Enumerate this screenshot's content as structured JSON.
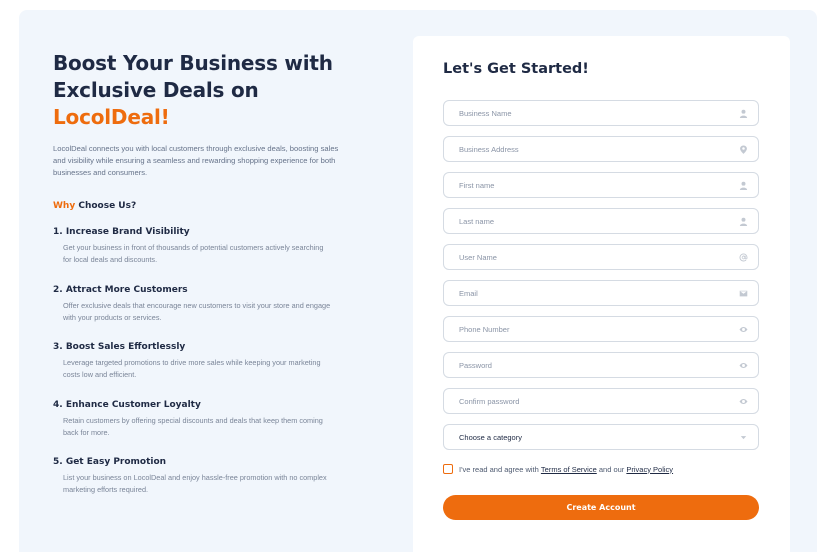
{
  "hero": {
    "title_line1": "Boost Your Business with",
    "title_line2": "Exclusive Deals on",
    "brand": "LocolDeal!",
    "intro": "LocolDeal connects you with local customers through exclusive deals, boosting sales and visibility while ensuring a seamless and rewarding shopping experience for both businesses and consumers."
  },
  "why": {
    "accent": "Why",
    "rest": " Choose Us?"
  },
  "features": [
    {
      "title": "1. Increase Brand Visibility",
      "desc": "Get your business in front of thousands of potential customers actively searching for local deals and discounts."
    },
    {
      "title": "2. Attract More Customers",
      "desc": "Offer exclusive deals that encourage new customers to visit your store and engage with your products or services."
    },
    {
      "title": "3. Boost Sales Effortlessly",
      "desc": "Leverage targeted promotions to drive more sales while keeping your marketing costs low and efficient."
    },
    {
      "title": "4. Enhance Customer Loyalty",
      "desc": "Retain customers by offering special discounts and deals that keep them coming back for more."
    },
    {
      "title": "5. Get Easy Promotion",
      "desc": "List your business on LocolDeal and enjoy hassle-free promotion with no complex marketing efforts required."
    }
  ],
  "form": {
    "title": "Let's Get Started!",
    "fields": {
      "business_name": {
        "placeholder": "Business Name",
        "icon": "user-icon"
      },
      "business_address": {
        "placeholder": "Business Address",
        "icon": "location-pin-icon"
      },
      "first_name": {
        "placeholder": "First name",
        "icon": "user-icon"
      },
      "last_name": {
        "placeholder": "Last name",
        "icon": "user-icon"
      },
      "user_name": {
        "placeholder": "User Name",
        "icon": "at-sign-icon"
      },
      "email": {
        "placeholder": "Email",
        "icon": "envelope-icon"
      },
      "phone": {
        "placeholder": "Phone Number",
        "icon": "eye-icon"
      },
      "password": {
        "placeholder": "Password",
        "icon": "eye-icon"
      },
      "confirm_password": {
        "placeholder": "Confirm password",
        "icon": "eye-icon"
      }
    },
    "category": {
      "value": "Choose a category",
      "icon": "chevron-down-icon"
    },
    "agree": {
      "prefix": "I've read and agree with ",
      "terms": "Terms of Service",
      "middle": " and our ",
      "privacy": "Privacy Policy"
    },
    "submit_label": "Create Account"
  },
  "colors": {
    "accent": "#ee6c0e",
    "heading": "#1f2a44",
    "panel_bg": "#f1f6fc"
  }
}
